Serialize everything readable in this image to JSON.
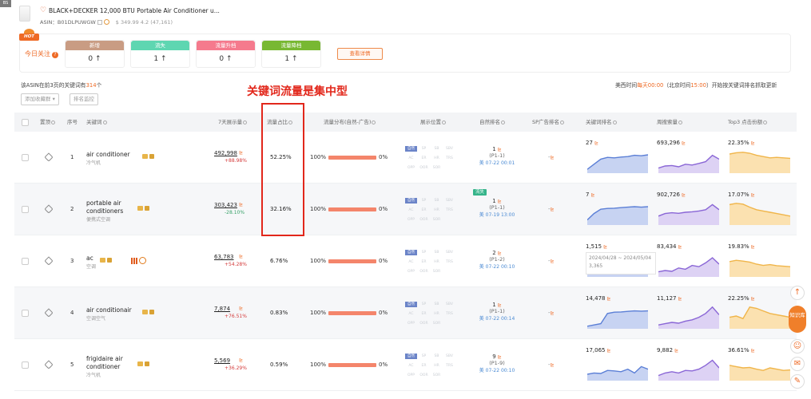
{
  "header": {
    "corner_tag": "BS",
    "title": "BLACK+DECKER 12,000 BTU Portable Air Conditioner u...",
    "asin_label": "ASIN：",
    "asin": "B01DLPUWGW",
    "price_rating": "$ 349.99 4.2 (47,161)"
  },
  "focus": {
    "hot": "HOT",
    "label": "今日关注",
    "cards": [
      {
        "title": "新增",
        "value": "0",
        "color": "#c99c83"
      },
      {
        "title": "流失",
        "value": "1",
        "color": "#5ed6b1"
      },
      {
        "title": "流量升档",
        "value": "0",
        "color": "#f57a8d"
      },
      {
        "title": "流量降档",
        "value": "1",
        "color": "#78b832"
      }
    ],
    "view_details": "查看详情"
  },
  "summary": {
    "prefix": "该ASIN在前3页的关键词有",
    "count": "314",
    "suffix": "个",
    "annotation": "关键词流量是集中型",
    "time_a": "美西时间",
    "time_b": "每天00:00",
    "time_c": "（北京时间",
    "time_d": "15:00",
    "time_e": "）开始按关键词排名抓取更新",
    "btn_add": "添加收藏群 ▾",
    "btn_monitor": "排名监控"
  },
  "columns": {
    "pin": "置顶",
    "index": "序号",
    "keyword": "关键词",
    "vol7": "7天展示量",
    "share": "流量占比",
    "dist": "流量分布(自然-广告)",
    "position": "展示位置",
    "organic": "自然排名",
    "sp": "SP广告排名",
    "kwrank": "关键词排名",
    "search": "周搜索量",
    "top3": "Top3 点击份额"
  },
  "position_labels": [
    "自然",
    "SP",
    "SB",
    "SBV",
    "AC",
    "ER",
    "HR",
    "TRS",
    "OPP",
    "OOR",
    "SOR"
  ],
  "rows": [
    {
      "n": "1",
      "kw": "air conditioner",
      "kw2": "",
      "tr": "冷气机",
      "vol": "492,998",
      "chg": "+88.98%",
      "chg_dir": "up",
      "share": "52.25%",
      "share_pct": 52.25,
      "dl": "100%",
      "dr": "0%",
      "rank": "1",
      "page": "(P1-1)",
      "date": "美 07-22 00:01",
      "lost": "",
      "sp": "-",
      "kwr": "27",
      "sv": "693,296",
      "t3": "22.35%"
    },
    {
      "n": "2",
      "kw": "portable air",
      "kw2": "conditioners",
      "tr": "便携式空调",
      "vol": "303,423",
      "chg": "-28.10%",
      "chg_dir": "down",
      "share": "32.16%",
      "share_pct": 32.16,
      "dl": "100%",
      "dr": "0%",
      "rank": "1",
      "page": "(P1-1)",
      "date": "美 07-19 13:00",
      "lost": "流失",
      "sp": "-",
      "kwr": "7",
      "sv": "902,726",
      "t3": "17.07%"
    },
    {
      "n": "3",
      "kw": "ac",
      "kw2": "",
      "tr": "空调",
      "vol": "63,783",
      "chg": "+54.28%",
      "chg_dir": "up",
      "share": "6.76%",
      "share_pct": 6.76,
      "dl": "100%",
      "dr": "0%",
      "rank": "2",
      "page": "(P1-2)",
      "date": "美 07-22 00:10",
      "lost": "",
      "sp": "-",
      "kwr": "1,515",
      "sv": "83,434",
      "t3": "19.83%"
    },
    {
      "n": "4",
      "kw": "air conditionair",
      "kw2": "",
      "tr": "空调空气",
      "vol": "7,874",
      "chg": "+76.51%",
      "chg_dir": "up",
      "share": "0.83%",
      "share_pct": 0.83,
      "dl": "100%",
      "dr": "0%",
      "rank": "1",
      "page": "(P1-1)",
      "date": "美 07-22 00:14",
      "lost": "",
      "sp": "-",
      "kwr": "14,478",
      "sv": "11,127",
      "t3": "22.25%"
    },
    {
      "n": "5",
      "kw": "frigidaire air",
      "kw2": "conditioner",
      "tr": "冷气机",
      "vol": "5,569",
      "chg": "+36.29%",
      "chg_dir": "up",
      "share": "0.59%",
      "share_pct": 0.59,
      "dl": "100%",
      "dr": "0%",
      "rank": "9",
      "page": "(P1-9)",
      "date": "美 07-22 00:10",
      "lost": "",
      "sp": "-",
      "kwr": "17,065",
      "sv": "9,882",
      "t3": "36.61%"
    }
  ],
  "tooltip": {
    "range": "2024/04/28 ~ 2024/05/04",
    "value": "3,365"
  },
  "side": {
    "up": "↑",
    "lib": "知识库"
  },
  "colors": {
    "accent": "#ee6a25",
    "rank_fill": "#c7d3f2",
    "search_fill": "#ddd2f4",
    "top3_fill": "#fbe1b0"
  }
}
